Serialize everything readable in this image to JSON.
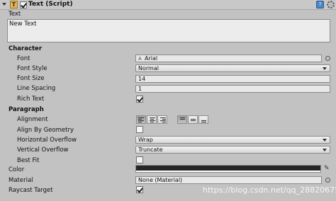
{
  "header": {
    "enabled": true,
    "title": "Text (Script)",
    "component_icon_letter": "T",
    "help_icon": "book-icon",
    "settings_icon": "gear-icon"
  },
  "text_section": {
    "label": "Text",
    "value": "New Text"
  },
  "character": {
    "heading": "Character",
    "font": {
      "label": "Font",
      "value": "Arial",
      "icon": "font-asset-icon"
    },
    "font_style": {
      "label": "Font Style",
      "value": "Normal"
    },
    "font_size": {
      "label": "Font Size",
      "value": "14"
    },
    "line_spacing": {
      "label": "Line Spacing",
      "value": "1"
    },
    "rich_text": {
      "label": "Rich Text",
      "checked": true
    }
  },
  "paragraph": {
    "heading": "Paragraph",
    "alignment": {
      "label": "Alignment",
      "horizontal_selected": "left",
      "vertical_selected": "top"
    },
    "align_by_geometry": {
      "label": "Align By Geometry",
      "checked": false
    },
    "horizontal_overflow": {
      "label": "Horizontal Overflow",
      "value": "Wrap"
    },
    "vertical_overflow": {
      "label": "Vertical Overflow",
      "value": "Truncate"
    },
    "best_fit": {
      "label": "Best Fit",
      "checked": false
    }
  },
  "color": {
    "label": "Color",
    "value": "#262626"
  },
  "material": {
    "label": "Material",
    "value": "None (Material)"
  },
  "raycast_target": {
    "label": "Raycast Target",
    "checked": true
  },
  "watermark": "https://blog.csdn.net/qq_28820675"
}
